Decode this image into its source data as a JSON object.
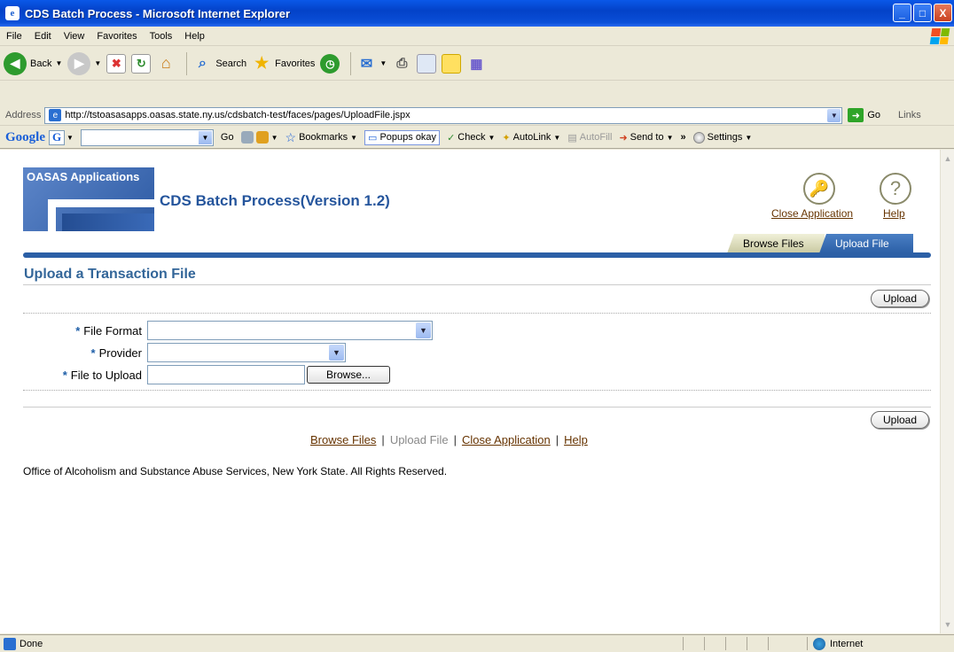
{
  "window": {
    "title": "CDS Batch Process - Microsoft Internet Explorer",
    "minimize": "_",
    "maximize": "□",
    "close": "X"
  },
  "menu": {
    "items": [
      {
        "label": "File"
      },
      {
        "label": "Edit"
      },
      {
        "label": "View"
      },
      {
        "label": "Favorites"
      },
      {
        "label": "Tools"
      },
      {
        "label": "Help"
      }
    ]
  },
  "toolbar": {
    "back": "Back",
    "search": "Search",
    "favorites": "Favorites"
  },
  "address": {
    "label": "Address",
    "url": "http://tstoasasapps.oasas.state.ny.us/cdsbatch-test/faces/pages/UploadFile.jspx",
    "go": "Go",
    "links": "Links"
  },
  "google_bar": {
    "logo": "Google",
    "g_letter": "G",
    "go": "Go",
    "bookmarks": "Bookmarks",
    "popups": "Popups okay",
    "check": "Check",
    "autolink": "AutoLink",
    "autofill": "AutoFill",
    "sendto": "Send to",
    "settings": "Settings"
  },
  "page": {
    "brand": "OASAS Applications",
    "app_title": "CDS Batch Process(Version 1.2)",
    "close_application": "Close Application",
    "help": "Help",
    "tabs": [
      {
        "label": "Browse Files",
        "active": false
      },
      {
        "label": "Upload File",
        "active": true
      }
    ],
    "section_title": "Upload a Transaction File",
    "upload_button": "Upload",
    "form": {
      "required_marker": "*",
      "file_format_label": "File Format",
      "file_format_value": "",
      "provider_label": "Provider",
      "provider_value": "",
      "file_to_upload_label": "File to Upload",
      "file_to_upload_value": "",
      "browse_button": "Browse..."
    },
    "footer_links": [
      {
        "label": "Browse Files",
        "current": false
      },
      {
        "label": "Upload File",
        "current": true
      },
      {
        "label": "Close Application",
        "current": false
      },
      {
        "label": "Help",
        "current": false
      }
    ],
    "footer_separator": "|",
    "copyright": "Office of Alcoholism and Substance Abuse Services, New York State. All Rights Reserved."
  },
  "status": {
    "text": "Done",
    "zone": "Internet"
  },
  "colors": {
    "xp_blue": "#0a4fd8",
    "brand_blue": "#2b5fa6",
    "link_brown": "#663300",
    "title_blue": "#336699"
  }
}
